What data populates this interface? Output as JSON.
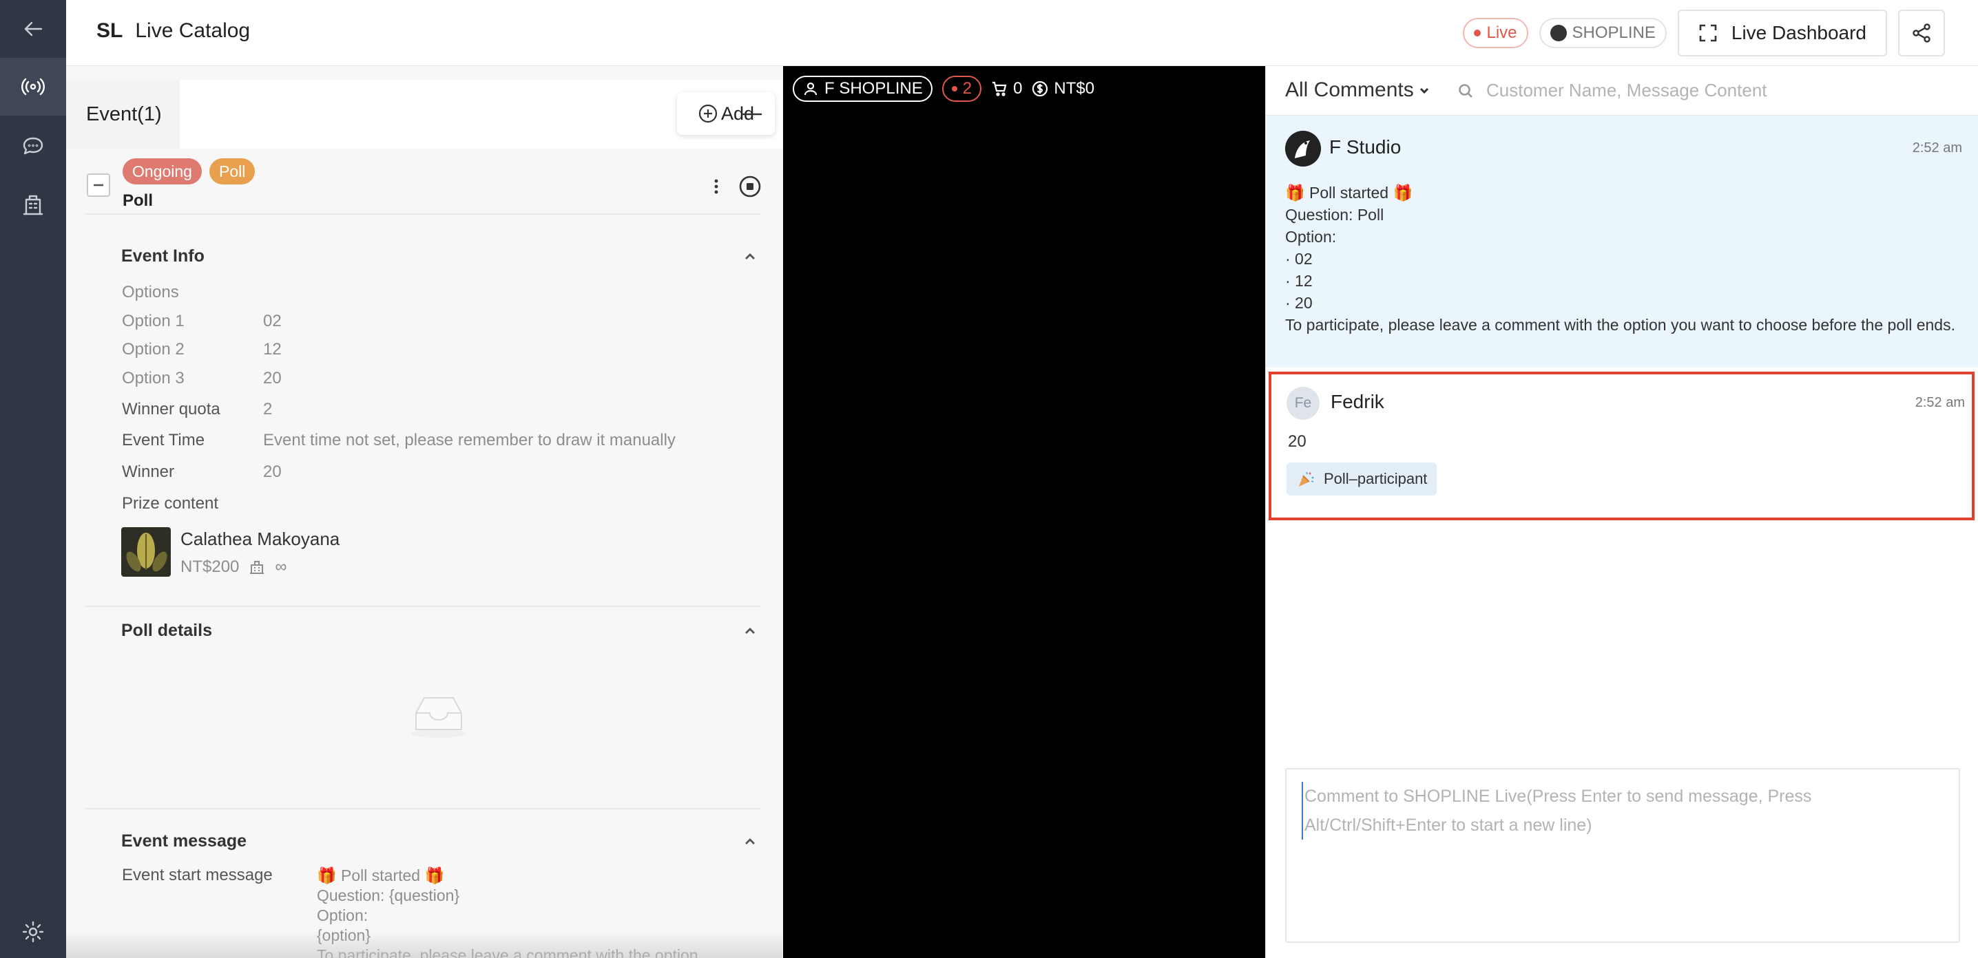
{
  "header": {
    "brand_short": "SL",
    "title": "Live Catalog",
    "live_label": "Live",
    "platform_label": "SHOPLINE",
    "dashboard_label": "Live Dashboard"
  },
  "event_panel": {
    "tab_label": "Event(1)",
    "add_label": "Add",
    "status_tag": "Ongoing",
    "type_tag": "Poll",
    "event_name": "Poll",
    "event_info": {
      "title": "Event Info",
      "options_label": "Options",
      "options": [
        {
          "label": "Option 1",
          "value": "02"
        },
        {
          "label": "Option 2",
          "value": "12"
        },
        {
          "label": "Option 3",
          "value": "20"
        }
      ],
      "winner_quota_label": "Winner quota",
      "winner_quota": "2",
      "event_time_label": "Event Time",
      "event_time": "Event time not set, please remember to draw it manually",
      "winner_label": "Winner",
      "winner": "20",
      "prize_label": "Prize content",
      "prize_name": "Calathea Makoyana",
      "prize_price": "NT$200",
      "prize_stock": "∞"
    },
    "poll_details_title": "Poll details",
    "event_message": {
      "title": "Event message",
      "start_label": "Event start message",
      "start_text": "🎁 Poll started 🎁\nQuestion: {question}\nOption:\n{option}\nTo participate, please leave a comment with the option"
    }
  },
  "video": {
    "host": "F SHOPLINE",
    "viewers": "2",
    "cart": "0",
    "sales": "NT$0"
  },
  "comments": {
    "filter_label": "All Comments",
    "search_placeholder": "Customer Name, Message Content",
    "messages": [
      {
        "author": "F Studio",
        "time": "2:52 am",
        "text": "🎁 Poll started 🎁\nQuestion: Poll\nOption:\n· 02\n· 12\n· 20\nTo participate, please leave a comment with the option you want to choose before the poll ends."
      },
      {
        "author": "Fedrik",
        "initials": "Fe",
        "time": "2:52 am",
        "text": "20",
        "badge": "Poll–participant"
      }
    ],
    "compose_placeholder": "Comment to SHOPLINE Live(Press Enter to send message, Press Alt/Ctrl/Shift+Enter to start a new line)"
  },
  "colors": {
    "rail": "#303643",
    "live_red": "#e0574a",
    "ongoing_tag": "#de7a6f",
    "poll_tag": "#e8a04f",
    "highlight_border": "#e0402e",
    "system_message_bg": "#eaf5fc"
  }
}
